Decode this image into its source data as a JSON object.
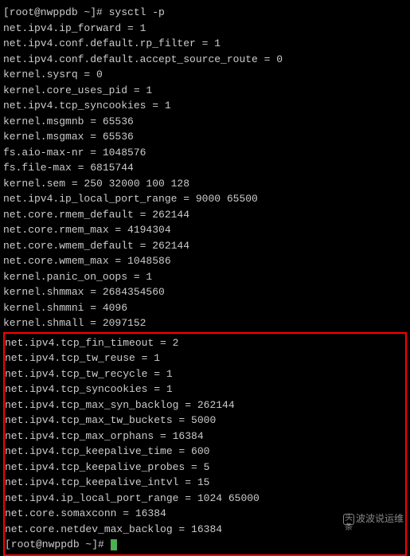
{
  "prompt1": "[root@nwppdb ~]# ",
  "command": "sysctl -p",
  "output": [
    "net.ipv4.ip_forward = 1",
    "net.ipv4.conf.default.rp_filter = 1",
    "net.ipv4.conf.default.accept_source_route = 0",
    "kernel.sysrq = 0",
    "kernel.core_uses_pid = 1",
    "net.ipv4.tcp_syncookies = 1",
    "kernel.msgmnb = 65536",
    "kernel.msgmax = 65536",
    "fs.aio-max-nr = 1048576",
    "fs.file-max = 6815744",
    "kernel.sem = 250 32000 100 128",
    "net.ipv4.ip_local_port_range = 9000 65500",
    "net.core.rmem_default = 262144",
    "net.core.rmem_max = 4194304",
    "net.core.wmem_default = 262144",
    "net.core.wmem_max = 1048586",
    "kernel.panic_on_oops = 1",
    "kernel.shmmax = 2684354560",
    "kernel.shmmni = 4096",
    "kernel.shmall = 2097152"
  ],
  "highlighted": [
    "net.ipv4.tcp_fin_timeout = 2",
    "net.ipv4.tcp_tw_reuse = 1",
    "net.ipv4.tcp_tw_recycle = 1",
    "net.ipv4.tcp_syncookies = 1",
    "net.ipv4.tcp_max_syn_backlog = 262144",
    "net.ipv4.tcp_max_tw_buckets = 5000",
    "net.ipv4.tcp_max_orphans = 16384",
    "net.ipv4.tcp_keepalive_time = 600",
    "net.ipv4.tcp_keepalive_probes = 5",
    "net.ipv4.tcp_keepalive_intvl = 15",
    "net.ipv4.ip_local_port_range = 1024 65000",
    "net.core.somaxconn = 16384",
    "net.core.netdev_max_backlog = 16384"
  ],
  "prompt2": "[root@nwppdb ~]# ",
  "watermark": "波波说运维"
}
